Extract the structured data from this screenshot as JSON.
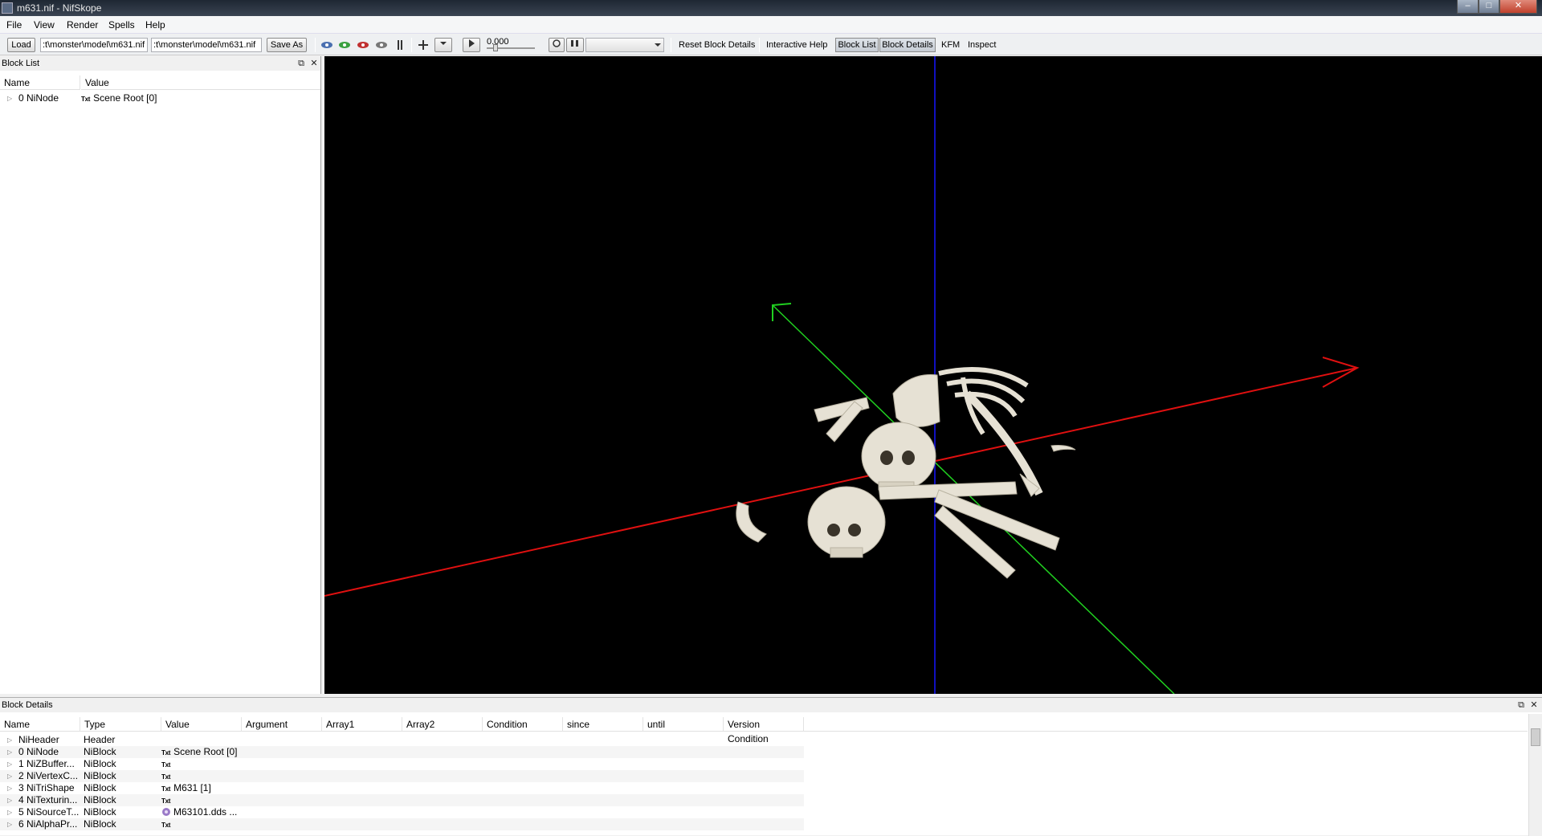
{
  "window": {
    "title": "m631.nif - NifSkope",
    "controls": {
      "minimize": "–",
      "maximize": "□",
      "close": "✕"
    }
  },
  "menu": [
    "File",
    "View",
    "Render",
    "Spells",
    "Help"
  ],
  "toolbar": {
    "load_label": "Load",
    "load_path": ":t\\monster\\model\\m631.nif",
    "save_path": ":t\\monster\\model\\m631.nif",
    "save_as_label": "Save As",
    "time_value": "0.000",
    "reset_block_details": "Reset Block Details",
    "interactive_help": "Interactive Help",
    "block_list": "Block List",
    "block_details": "Block Details",
    "kfm": "KFM",
    "inspect": "Inspect"
  },
  "block_list": {
    "title": "Block List",
    "columns": [
      "Name",
      "Value"
    ],
    "rows": [
      {
        "name": "0 NiNode",
        "badge": "Txt",
        "value": "Scene Root [0]"
      }
    ]
  },
  "block_details": {
    "title": "Block Details",
    "columns": [
      "Name",
      "Type",
      "Value",
      "Argument",
      "Array1",
      "Array2",
      "Condition",
      "since",
      "until",
      "Version Condition"
    ],
    "rows": [
      {
        "name": "NiHeader",
        "type": "Header",
        "badge": "",
        "value": ""
      },
      {
        "name": "0 NiNode",
        "type": "NiBlock",
        "badge": "Txt",
        "value": "Scene Root [0]"
      },
      {
        "name": "1 NiZBuffer...",
        "type": "NiBlock",
        "badge": "Txt",
        "value": ""
      },
      {
        "name": "2 NiVertexC...",
        "type": "NiBlock",
        "badge": "Txt",
        "value": ""
      },
      {
        "name": "3 NiTriShape",
        "type": "NiBlock",
        "badge": "Txt",
        "value": "M631 [1]"
      },
      {
        "name": "4 NiTexturin...",
        "type": "NiBlock",
        "badge": "Txt",
        "value": ""
      },
      {
        "name": "5 NiSourceT...",
        "type": "NiBlock",
        "badge": "img",
        "value": "M63101.dds ..."
      },
      {
        "name": "6 NiAlphaPr...",
        "type": "NiBlock",
        "badge": "Txt",
        "value": ""
      }
    ]
  },
  "colors": {
    "viewport_bg": "#000000",
    "axis_x": "#e01010",
    "axis_y": "#20d020",
    "axis_z": "#1010c0",
    "bone": "#e6e1d4"
  }
}
